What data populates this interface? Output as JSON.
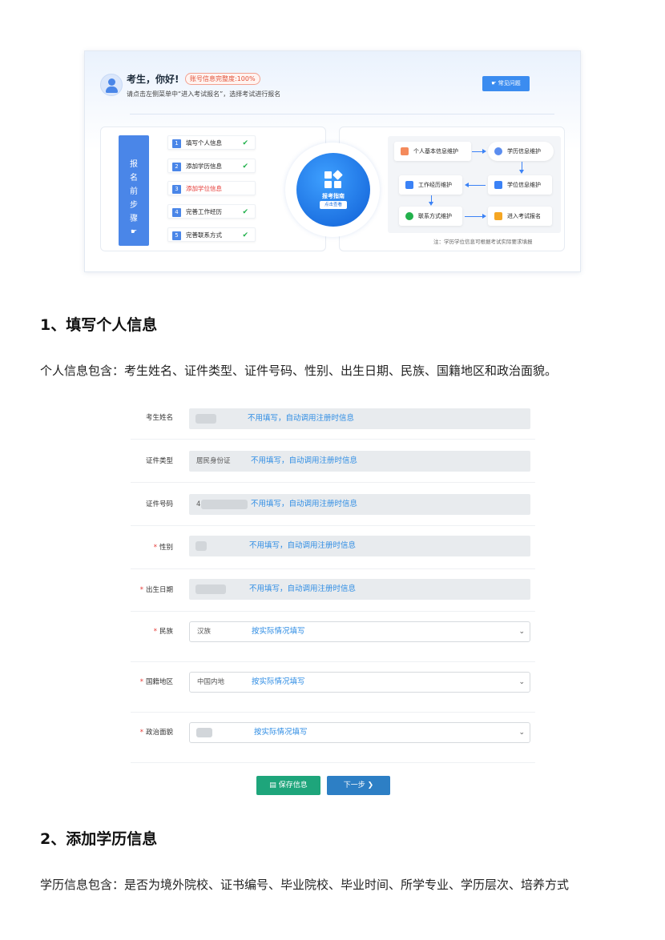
{
  "dashboard": {
    "greeting": "考生，你好!",
    "completeness_badge": "账号信息完整度:100%",
    "instruction": "请点击左侧菜单中“进入考试报名”，选择考试进行报名",
    "faq_button": "常见问题",
    "steps_title": "报名前步骤",
    "steps": [
      {
        "num": "1",
        "label": "填写个人信息",
        "done": "✔"
      },
      {
        "num": "2",
        "label": "添加学历信息",
        "done": "✔"
      },
      {
        "num": "3",
        "label": "添加学位信息",
        "done": ""
      },
      {
        "num": "4",
        "label": "完善工作经历",
        "done": "✔"
      },
      {
        "num": "5",
        "label": "完善联系方式",
        "done": "✔"
      }
    ],
    "guide_title": "报考指南",
    "guide_button": "点击查看",
    "flow": {
      "n1": "个人基本信息维护",
      "n2": "学历信息维护",
      "n3": "工作经历维护",
      "n4": "学位信息维护",
      "n5": "联系方式维护",
      "n6": "进入考试报名"
    },
    "note": "注：学历学位信息可根据考试实际要求填报"
  },
  "section1": {
    "heading": "1、填写个人信息",
    "desc": "个人信息包含：考生姓名、证件类型、证件号码、性别、出生日期、民族、国籍地区和政治面貌。"
  },
  "form": {
    "hint_auto": "不用填写，自动调用注册时信息",
    "hint_manual": "按实际情况填写",
    "req_mark": "*",
    "fields": [
      {
        "label": "考生姓名",
        "value": ""
      },
      {
        "label": "证件类型",
        "value": "居民身份证"
      },
      {
        "label": "证件号码",
        "value": "4"
      },
      {
        "label": "性别",
        "value": ""
      },
      {
        "label": "出生日期",
        "value": ""
      },
      {
        "label": "民族",
        "value": "汉族"
      },
      {
        "label": "国籍地区",
        "value": "中国内地"
      },
      {
        "label": "政治面貌",
        "value": ""
      }
    ],
    "save_button": "保存信息",
    "next_button": "下一步"
  },
  "section2": {
    "heading": "2、添加学历信息",
    "desc": "学历信息包含：是否为境外院校、证书编号、毕业院校、毕业时间、所学专业、学历层次、培养方式"
  },
  "colors": {
    "primary_blue": "#4a86e8",
    "hint_blue": "#2f8de4",
    "save_green": "#1ea57b",
    "next_blue": "#2d7fc5",
    "required_red": "#e53935"
  }
}
